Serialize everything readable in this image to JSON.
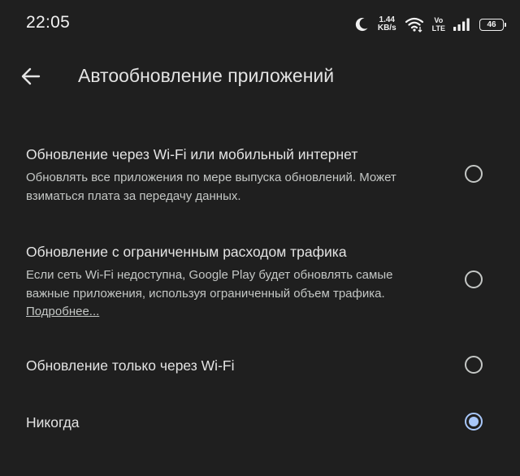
{
  "status_bar": {
    "time": "22:05",
    "net_speed_value": "1.44",
    "net_speed_unit": "KB/s",
    "volte_top": "Vo",
    "volte_bottom": "LTE",
    "battery_level": "46",
    "icons": [
      "moon-icon",
      "wifi-icon",
      "signal-icon",
      "battery-icon"
    ]
  },
  "header": {
    "back_icon": "arrow-left-icon",
    "title": "Автообновление приложений"
  },
  "options": [
    {
      "title": "Обновление через Wi-Fi или мобильный интернет",
      "description": "Обновлять все приложения по мере выпуска обновлений. Может взиматься плата за передачу данных.",
      "selected": false
    },
    {
      "title": "Обновление с ограниченным расходом трафика",
      "description": "Если сеть Wi-Fi недоступна, Google Play будет обновлять самые важные приложения, используя ограниченный объем трафика.",
      "link": "Подробнее...",
      "selected": false
    },
    {
      "title": "Обновление только через Wi-Fi",
      "selected": false
    },
    {
      "title": "Никогда",
      "selected": true
    }
  ],
  "colors": {
    "background": "#1f1f1f",
    "text_primary": "#e3e3e3",
    "text_secondary": "#c4c7c5",
    "accent": "#a8c7fa"
  }
}
